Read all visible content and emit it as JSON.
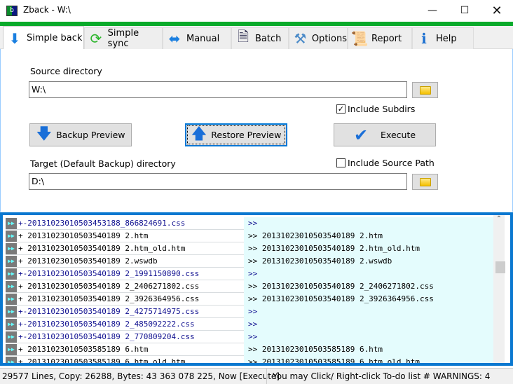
{
  "window": {
    "title": "Zback - W:\\",
    "icon_text": "Zb"
  },
  "tabs": [
    {
      "label": "Simple back",
      "icon": "arrow-down-icon",
      "active": true
    },
    {
      "label": "Simple sync",
      "icon": "sync-icon"
    },
    {
      "label": "Manual",
      "icon": "double-arrow-icon"
    },
    {
      "label": "Batch",
      "icon": "document-icon"
    },
    {
      "label": "Options",
      "icon": "tools-icon"
    },
    {
      "label": "Report",
      "icon": "scroll-icon"
    },
    {
      "label": "Help",
      "icon": "info-icon"
    }
  ],
  "form": {
    "source_label": "Source directory",
    "source_value": "W:\\",
    "include_subdirs": {
      "label": "Include Subdirs",
      "checked": true
    },
    "backup_preview": "Backup Preview",
    "restore_preview": "Restore Preview",
    "execute": "Execute",
    "target_label": "Target (Default Backup) directory",
    "target_value": "D:\\",
    "include_source_path": {
      "label": "Include Source Path",
      "checked": false
    }
  },
  "list": [
    {
      "left": "+-20131023010503453188_866824691.css",
      "right": ">>",
      "status": "removed"
    },
    {
      "left": "+ 20131023010503540189 2.htm",
      "right": ">> 20131023010503540189 2.htm",
      "status": "copy"
    },
    {
      "left": "+ 20131023010503540189 2.htm_old.htm",
      "right": ">> 20131023010503540189 2.htm_old.htm",
      "status": "copy"
    },
    {
      "left": "+ 20131023010503540189 2.wswdb",
      "right": ">> 20131023010503540189 2.wswdb",
      "status": "copy"
    },
    {
      "left": "+-20131023010503540189 2_1991150890.css",
      "right": ">>",
      "status": "removed"
    },
    {
      "left": "+ 20131023010503540189 2_2406271802.css",
      "right": ">> 20131023010503540189 2_2406271802.css",
      "status": "copy"
    },
    {
      "left": "+ 20131023010503540189 2_3926364956.css",
      "right": ">> 20131023010503540189 2_3926364956.css",
      "status": "copy"
    },
    {
      "left": "+-20131023010503540189 2_4275714975.css",
      "right": ">>",
      "status": "removed"
    },
    {
      "left": "+-20131023010503540189 2_485092222.css",
      "right": ">>",
      "status": "removed"
    },
    {
      "left": "+-20131023010503540189 2_770809204.css",
      "right": ">>",
      "status": "removed"
    },
    {
      "left": "+ 20131023010503585189 6.htm",
      "right": ">> 20131023010503585189 6.htm",
      "status": "copy"
    },
    {
      "left": "+ 20131023010503585189 6.htm_old.htm",
      "right": ">> 20131023010503585189 6.htm_old.htm",
      "status": "copy"
    }
  ],
  "status": {
    "left": "29577  Lines, Copy: 26288,  Bytes: 43 363 078 225, Now [Execute]",
    "right": "You may Click/ Right-click To-do list  # WARNINGS: 4"
  },
  "colors": {
    "accent_green": "#0aaa2a",
    "list_border": "#0a78d0",
    "right_bg": "#e4fcfd",
    "removed_text": "#101090"
  }
}
